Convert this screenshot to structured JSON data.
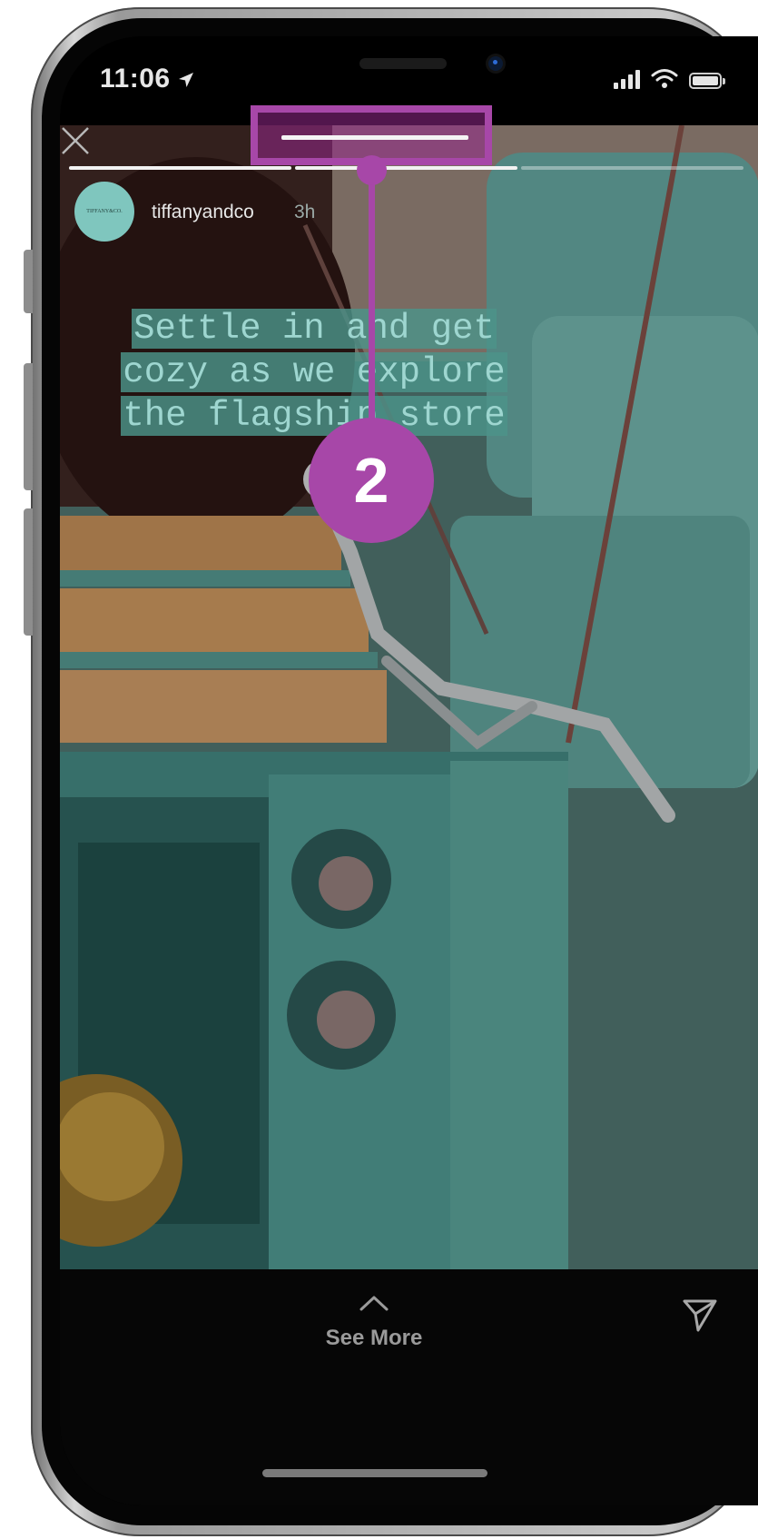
{
  "status_bar": {
    "time": "11:06",
    "location_icon": "location-arrow-icon",
    "icons": [
      "cellular-signal-icon",
      "wifi-icon",
      "battery-icon"
    ]
  },
  "story": {
    "username": "tiffanyandco",
    "timestamp": "3h",
    "avatar_text": "TIFFANY&CO.",
    "caption": "Settle in and get cozy as we explore the flagship store",
    "caption_color": "#9ed6d0",
    "caption_bg": "#4c948a",
    "close_icon": "close-icon",
    "progress": {
      "segments": 3,
      "current_segment": 2,
      "current_fill": 1.0
    }
  },
  "bottom": {
    "see_more_label": "See More",
    "chevron_icon": "chevron-up-icon",
    "send_icon": "send-icon"
  },
  "tutorial": {
    "step_number": "2",
    "accent_color": "#a747a8"
  }
}
